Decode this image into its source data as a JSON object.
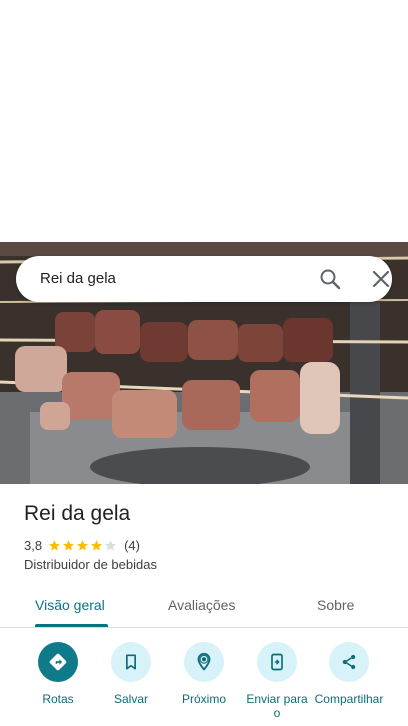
{
  "search": {
    "query": "Rei da gela",
    "search_icon": "search-icon",
    "close_icon": "close-icon"
  },
  "place": {
    "title": "Rei da gela",
    "rating": "3,8",
    "stars_filled": 4,
    "stars_total": 5,
    "review_count": "(4)",
    "category": "Distribuidor de bebidas"
  },
  "tabs": [
    {
      "label": "Visão geral",
      "active": true
    },
    {
      "label": "Avaliações",
      "active": false
    },
    {
      "label": "Sobre",
      "active": false
    }
  ],
  "actions": [
    {
      "label": "Rotas",
      "icon": "directions-icon"
    },
    {
      "label": "Salvar",
      "icon": "bookmark-icon"
    },
    {
      "label": "Próximo",
      "icon": "nearby-icon"
    },
    {
      "label": "Enviar para o",
      "icon": "send-to-phone-icon"
    },
    {
      "label": "Compartilhar",
      "icon": "share-icon"
    }
  ],
  "colors": {
    "accent": "#0b7285",
    "star": "#fbbc04",
    "star_empty": "#dadce0",
    "action_bg": "#d7f2f8",
    "action_primary": "#0e7a8a"
  }
}
